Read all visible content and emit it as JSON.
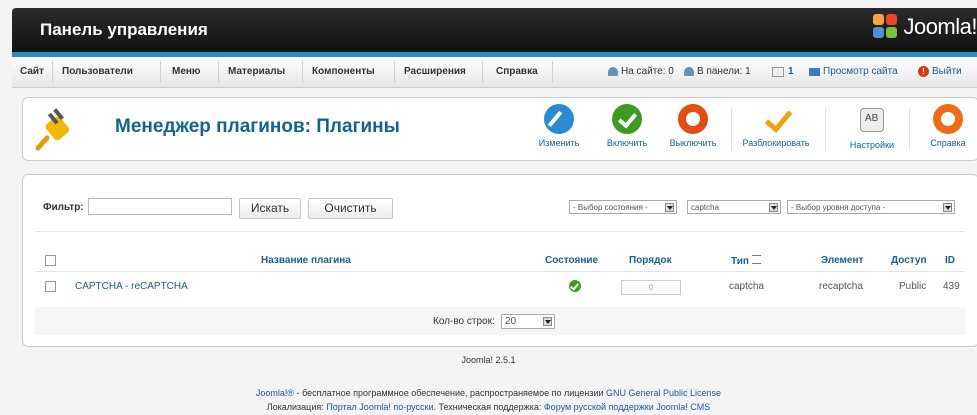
{
  "header": {
    "title": "Панель управления",
    "logo_text": "Joomla!"
  },
  "menu": [
    "Сайт",
    "Пользователи",
    "Меню",
    "Материалы",
    "Компоненты",
    "Расширения",
    "Справка"
  ],
  "status": {
    "on_site": "На сайте: 0",
    "in_panel": "В панели: 1",
    "messages": "1",
    "view_site": "Просмотр сайта",
    "logout": "Выйти"
  },
  "toolbar": {
    "title": "Менеджер плагинов: Плагины",
    "buttons": [
      "Изменить",
      "Включить",
      "Выключить",
      "Разблокировать",
      "Настройки",
      "Справка"
    ]
  },
  "filter": {
    "label": "Фильтр:",
    "search": "Искать",
    "clear": "Очистить",
    "state": "- Выбор состояния -",
    "type": "captcha",
    "access": "- Выбор уровня доступа -"
  },
  "table": {
    "headers": [
      "Название плагина",
      "Состояние",
      "Порядок",
      "Тип",
      "Элемент",
      "Доступ",
      "ID"
    ],
    "rows": [
      {
        "name": "CAPTCHA - reCAPTCHA",
        "order": "0",
        "type": "captcha",
        "element": "recaptcha",
        "access": "Public",
        "id": "439"
      }
    ]
  },
  "pagination": {
    "label": "Кол-во строк:",
    "value": "20"
  },
  "footer": {
    "version": "Joomla! 2.5.1",
    "l1_a": "Joomla!®",
    "l1_b": " - бесплатное программное обеспечение, распространяемое по лицензии ",
    "l1_c": "GNU General Public License",
    "l2_a": "Локализация: ",
    "l2_b": "Портал Joomla! по-русски",
    "l2_c": ". Техническая поддержка: ",
    "l2_d": "Форум русской поддержки Joomla! CMS"
  },
  "colors": {
    "accent": "#146295",
    "strip": "#2b8cc4",
    "header": "#1b1b1b"
  }
}
